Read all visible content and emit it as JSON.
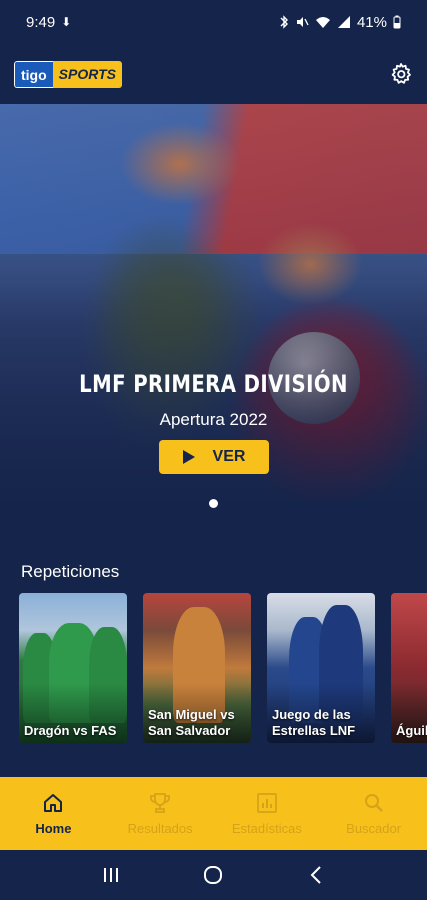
{
  "status_bar": {
    "time": "9:49",
    "battery": "41%",
    "icons": [
      "download-icon",
      "bluetooth-icon",
      "mute-icon",
      "wifi-icon",
      "signal-icon",
      "battery-icon"
    ]
  },
  "header": {
    "logo_left": "tigo",
    "logo_right": "SPORTS",
    "settings_icon": "gear-icon"
  },
  "hero": {
    "title": "LMF PRIMERA DIVISIÓN",
    "subtitle": "Apertura 2022",
    "button_label": "VER",
    "pagination_dots": 1
  },
  "repeticiones": {
    "title": "Repeticiones",
    "cards": [
      {
        "label": "Dragón vs FAS"
      },
      {
        "label": "San Miguel vs San Salvador"
      },
      {
        "label": "Juego de las Estrellas LNF"
      },
      {
        "label": "Águila"
      }
    ]
  },
  "bottom_nav": {
    "items": [
      {
        "label": "Home",
        "icon": "home-icon",
        "active": true
      },
      {
        "label": "Resultados",
        "icon": "trophy-icon",
        "active": false
      },
      {
        "label": "Estadísticas",
        "icon": "stats-icon",
        "active": false
      },
      {
        "label": "Buscador",
        "icon": "search-icon",
        "active": false
      }
    ]
  },
  "colors": {
    "background": "#15244a",
    "accent": "#f8c01a",
    "inactive_nav": "#d4a318"
  }
}
